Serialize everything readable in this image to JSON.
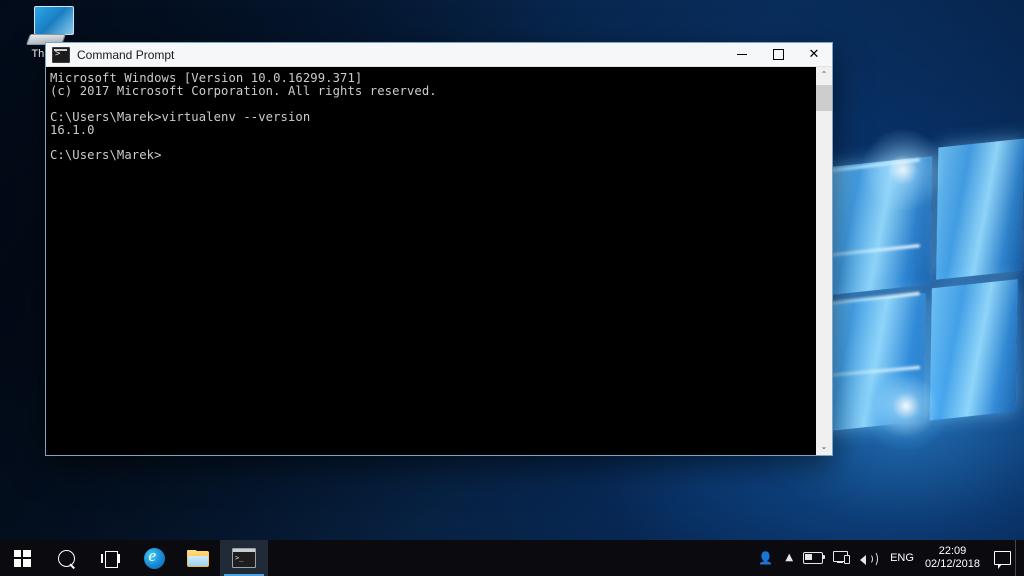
{
  "desktop": {
    "icons": [
      {
        "label": "This PC",
        "icon": "computer-icon"
      }
    ],
    "wallpaper_colors": {
      "deep_navy": "#05142c",
      "mid_blue": "#0a2f58",
      "glow_blue": "#41a8f0",
      "highlight": "#bfe8ff"
    }
  },
  "window": {
    "title": "Command Prompt",
    "icon": "cmd-icon",
    "controls": {
      "minimize": "–",
      "maximize": "⬜",
      "close": "✕"
    },
    "console": {
      "lines": [
        "Microsoft Windows [Version 10.0.16299.371]",
        "(c) 2017 Microsoft Corporation. All rights reserved.",
        "",
        "C:\\Users\\Marek>virtualenv --version",
        "16.1.0",
        "",
        "C:\\Users\\Marek>"
      ],
      "text_color": "#cccccc",
      "background_color": "#000000"
    },
    "scrollbar": {
      "up_arrow": "⌃",
      "down_arrow": "⌄"
    }
  },
  "taskbar": {
    "background_color": "#0a0a0f",
    "accent_color": "#4aa3e0",
    "left_buttons": [
      {
        "name": "start-button",
        "icon": "windows-logo-icon",
        "label": "Start"
      },
      {
        "name": "search-button",
        "icon": "search-icon",
        "label": "Search"
      },
      {
        "name": "task-view-button",
        "icon": "task-view-icon",
        "label": "Task View"
      },
      {
        "name": "edge-button",
        "icon": "edge-icon",
        "label": "Microsoft Edge"
      },
      {
        "name": "file-explorer-button",
        "icon": "folder-icon",
        "label": "File Explorer"
      },
      {
        "name": "command-prompt-button",
        "icon": "cmd-icon",
        "label": "Command Prompt",
        "active": true
      }
    ],
    "tray": {
      "people": {
        "icon": "people-icon",
        "label": "People"
      },
      "show_hidden": {
        "icon": "chevron-up-icon",
        "label": "Show hidden icons"
      },
      "battery": {
        "icon": "battery-icon",
        "label": "Battery"
      },
      "network": {
        "icon": "network-icon",
        "label": "Network"
      },
      "volume": {
        "icon": "speaker-icon",
        "label": "Volume"
      },
      "language": "ENG",
      "time": "22:09",
      "date": "02/12/2018",
      "action_center": {
        "icon": "action-center-icon",
        "label": "Action Center"
      }
    }
  }
}
